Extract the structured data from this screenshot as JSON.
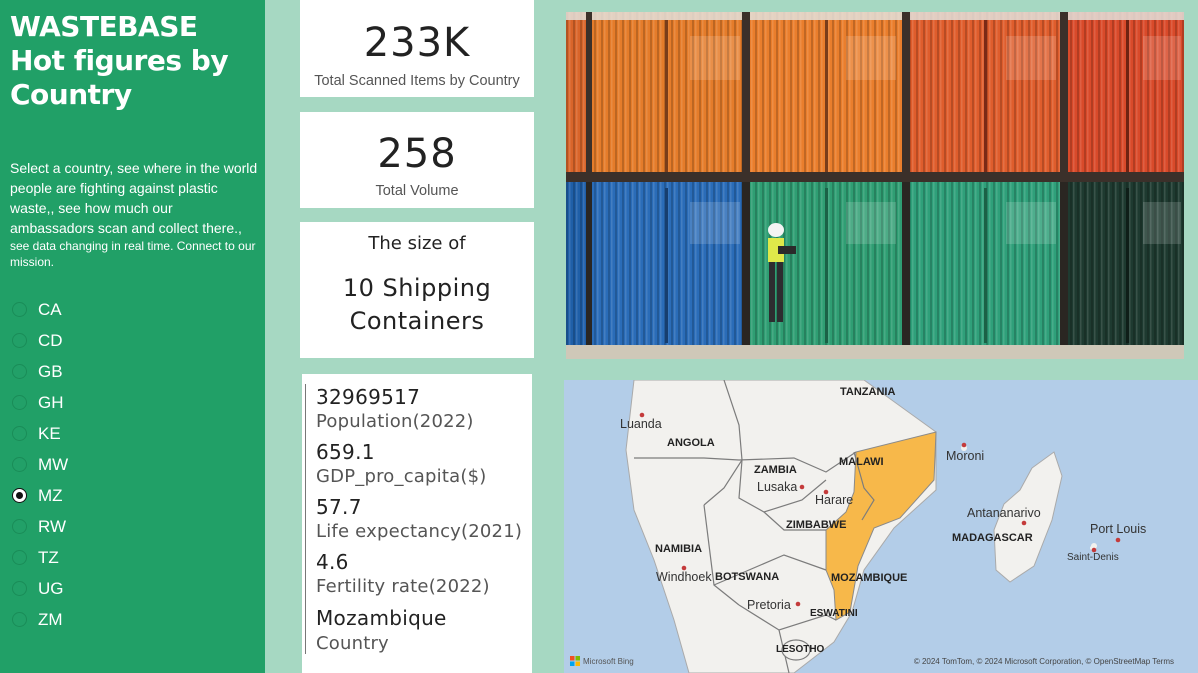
{
  "sidebar": {
    "title_line1": "WASTEBASE",
    "title_line2": "Hot figures by",
    "title_line3": "Country",
    "intro_main": "Select a country, see where in the world people are fighting against plastic waste,, see how much our ambassadors  scan and collect there.,",
    "intro_small": "see data changing in real time. Connect to our mission.",
    "countries": [
      "CA",
      "CD",
      "GB",
      "GH",
      "KE",
      "MW",
      "MZ",
      "RW",
      "TZ",
      "UG",
      "ZM"
    ],
    "selected": "MZ"
  },
  "kpi": {
    "scanned_value": "233K",
    "scanned_label": "Total Scanned Items by Country",
    "volume_value": "258",
    "volume_label": "Total Volume",
    "size_prefix": "The size of",
    "size_value_line1": "10 Shipping",
    "size_value_line2": "Containers"
  },
  "facts": {
    "population_value": "32969517",
    "population_label": "Population(2022)",
    "gdp_value": "659.1",
    "gdp_label": "GDP_pro_capita($)",
    "life_value": "57.7",
    "life_label": "Life expectancy(2021)",
    "fertility_value": "4.6",
    "fertility_label": "Fertility rate(2022)",
    "country_value": "Mozambique",
    "country_label": "Country"
  },
  "map": {
    "labels": {
      "tanzania": "TANZANIA",
      "luanda": "Luanda",
      "angola": "ANGOLA",
      "moroni": "Moroni",
      "malawi": "MALAWI",
      "zambia": "ZAMBIA",
      "lusaka": "Lusaka",
      "harare": "Harare",
      "zimbabwe": "ZIMBABWE",
      "antananarivo": "Antananarivo",
      "madagascar": "MADAGASCAR",
      "port_louis": "Port Louis",
      "saint_denis": "Saint-Denis",
      "namibia": "NAMIBIA",
      "windhoek": "Windhoek",
      "botswana": "BOTSWANA",
      "mozambique": "MOZAMBIQUE",
      "pretoria": "Pretoria",
      "eswatini": "ESWATINI",
      "lesotho": "LESOTHO"
    },
    "attribution": "© 2024 TomTom, © 2024 Microsoft Corporation, © OpenStreetMap  Terms",
    "provider": "Microsoft Bing",
    "colors": {
      "water": "#b3cde8",
      "land": "#f2f1ee",
      "highlight": "#f7b84a"
    }
  }
}
